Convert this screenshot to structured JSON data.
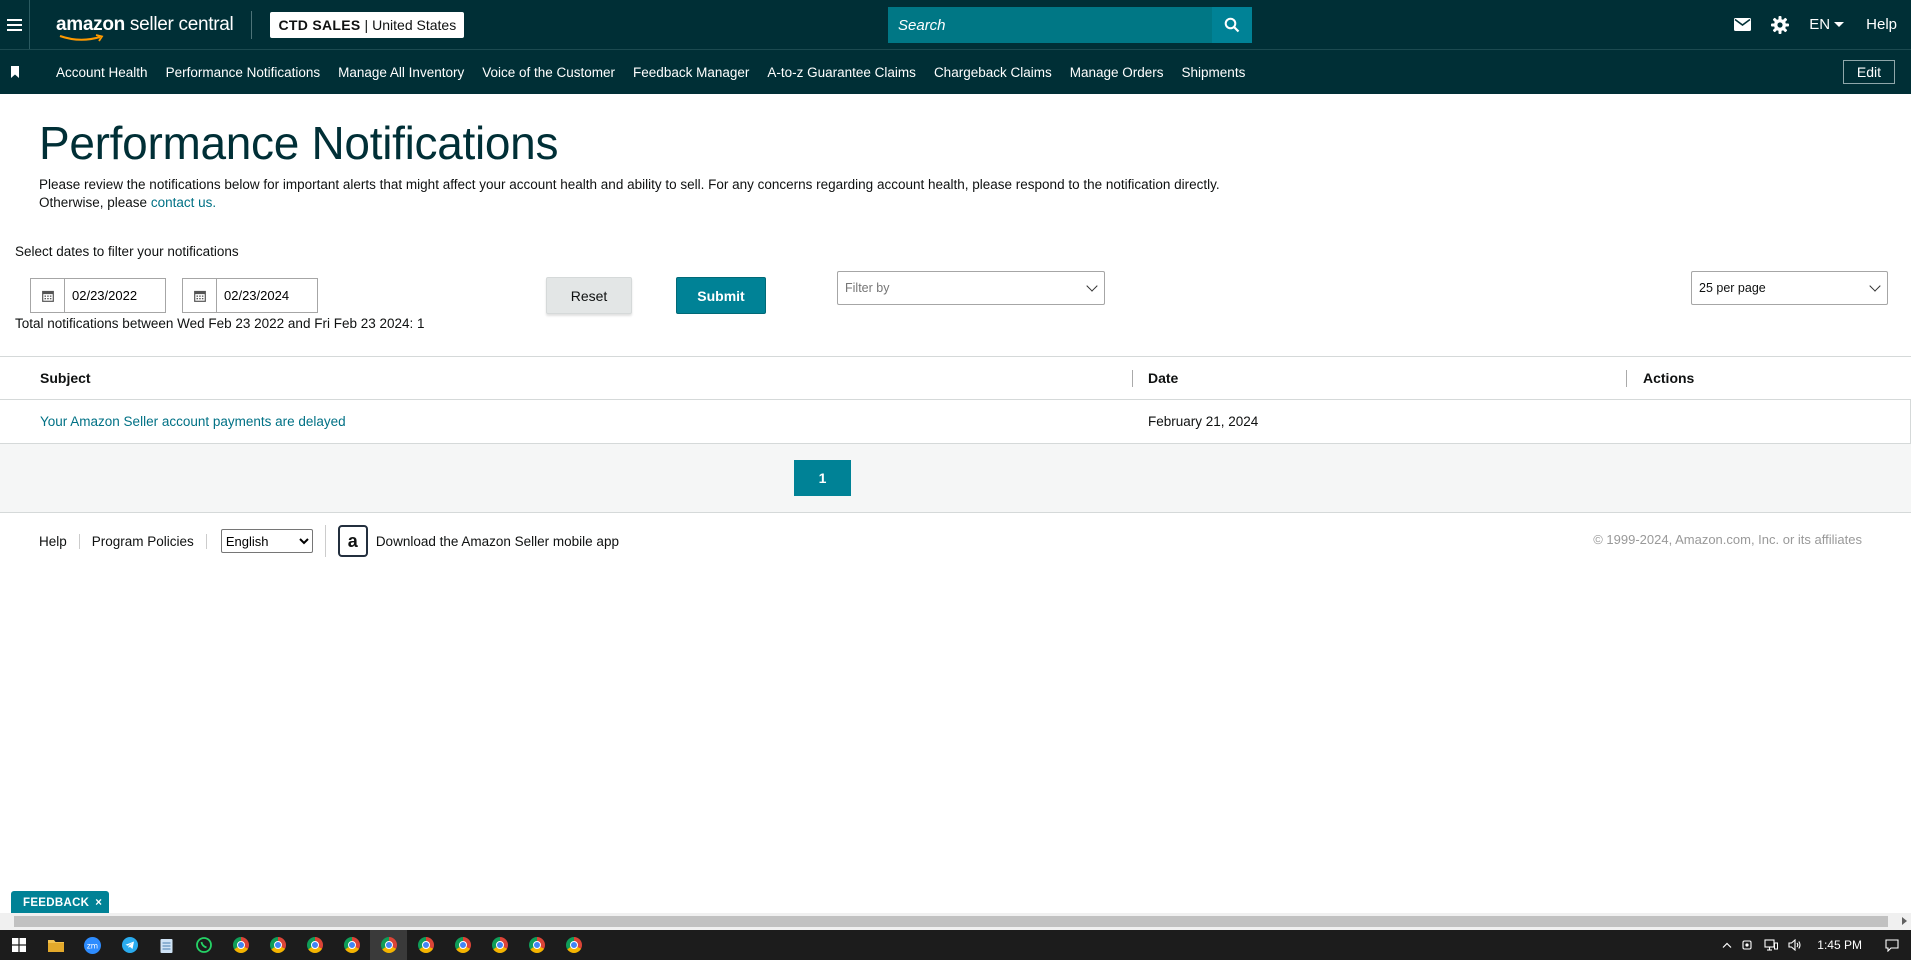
{
  "header": {
    "logo_bold": "amazon",
    "logo_rest": " seller central",
    "store_name": "CTD SALES",
    "store_separator": "|",
    "store_region": "United States",
    "search_placeholder": "Search",
    "language": "EN",
    "help": "Help"
  },
  "nav": {
    "items": [
      "Account Health",
      "Performance Notifications",
      "Manage All Inventory",
      "Voice of the Customer",
      "Feedback Manager",
      "A-to-z Guarantee Claims",
      "Chargeback Claims",
      "Manage Orders",
      "Shipments"
    ],
    "edit_label": "Edit"
  },
  "page": {
    "title": "Performance Notifications",
    "description_text": "Please review the notifications below for important alerts that might affect your account health and ability to sell. For any concerns regarding account health, please respond to the notification directly. Otherwise, please ",
    "description_link": "contact us.",
    "filter_label": "Select dates to filter your notifications",
    "start_date": "02/23/2022",
    "end_date": "02/23/2024",
    "reset_label": "Reset",
    "submit_label": "Submit",
    "filter_by_placeholder": "Filter by",
    "per_page": "25 per page",
    "total_text": "Total notifications between Wed Feb 23 2022 and Fri Feb 23 2024: 1"
  },
  "table": {
    "columns": [
      "Subject",
      "Date",
      "Actions"
    ],
    "rows": [
      {
        "subject": "Your Amazon Seller account payments are delayed",
        "date": "February 21, 2024",
        "actions": ""
      }
    ]
  },
  "pagination": {
    "current_page": "1"
  },
  "footer": {
    "help": "Help",
    "program_policies": "Program Policies",
    "language_selected": "English",
    "app_icon_letter": "a",
    "app_text": "Download the Amazon Seller mobile app",
    "copyright": "© 1999-2024, Amazon.com, Inc. or its affiliates"
  },
  "feedback": {
    "label": "FEEDBACK",
    "close": "×"
  },
  "taskbar": {
    "time": "1:45 PM",
    "zoom_label": "zm"
  },
  "colors": {
    "header_bg": "#002f36",
    "accent": "#008296",
    "link": "#007185"
  }
}
